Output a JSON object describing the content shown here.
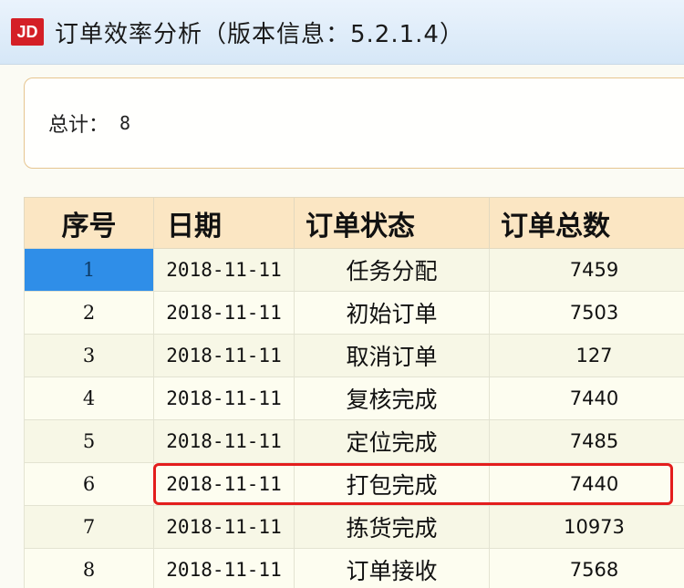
{
  "window": {
    "logo_text": "JD",
    "title": "订单效率分析（版本信息：5.2.1.4）"
  },
  "summary": {
    "label": "总计：",
    "value": "8"
  },
  "table": {
    "headers": [
      "序号",
      "日期",
      "订单状态",
      "订单总数"
    ],
    "rows": [
      {
        "no": "1",
        "date": "2018-11-11",
        "status": "任务分配",
        "total": "7459"
      },
      {
        "no": "2",
        "date": "2018-11-11",
        "status": "初始订单",
        "total": "7503"
      },
      {
        "no": "3",
        "date": "2018-11-11",
        "status": "取消订单",
        "total": "127"
      },
      {
        "no": "4",
        "date": "2018-11-11",
        "status": "复核完成",
        "total": "7440"
      },
      {
        "no": "5",
        "date": "2018-11-11",
        "status": "定位完成",
        "total": "7485"
      },
      {
        "no": "6",
        "date": "2018-11-11",
        "status": "打包完成",
        "total": "7440"
      },
      {
        "no": "7",
        "date": "2018-11-11",
        "status": "拣货完成",
        "total": "10973"
      },
      {
        "no": "8",
        "date": "2018-11-11",
        "status": "订单接收",
        "total": "7568"
      }
    ],
    "selected_row": 1,
    "highlighted_row": 6
  },
  "colors": {
    "logo": "#d41f26",
    "header_bg": "#fbe6c3",
    "selection": "#2f8ee8",
    "highlight_box": "#e31d1d"
  }
}
